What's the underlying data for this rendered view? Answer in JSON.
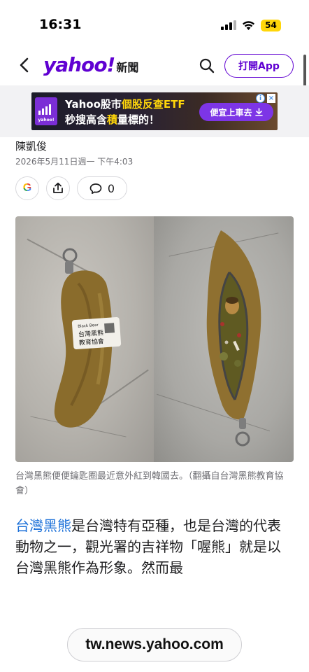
{
  "status_bar": {
    "time": "16:31",
    "battery": "54"
  },
  "header": {
    "brand": "yahoo!",
    "section": "新聞",
    "open_app_label": "打開App"
  },
  "ad": {
    "logo_text": "yahoo!",
    "line1_prefix": "Yahoo股市",
    "line1_highlight": "個股反查ETF",
    "line2_prefix": "秒搜高含",
    "line2_highlight": "積",
    "line2_suffix": "量標的！",
    "cta_label": "便宜上車去",
    "info_icon": "i",
    "close_icon": "×"
  },
  "article": {
    "author": "陳凱俊",
    "timestamp": "2026年5月11日週一 下午4:03",
    "comment_count": "0",
    "photo_tag_line1": "Black Bear",
    "photo_tag_line2": "台灣黑熊",
    "photo_tag_line3": "教育協會",
    "caption": "台灣黑熊便便鑰匙圈最近意外紅到韓國去。（翻攝自台灣黑熊教育協會）",
    "body_link": "台灣黑熊",
    "body_text": "是台灣特有亞種，也是台灣的代表動物之一，觀光署的吉祥物「喔熊」就是以台灣黑熊作為形象。然而最"
  },
  "browser": {
    "url": "tw.news.yahoo.com"
  },
  "colors": {
    "brand": "#6001d2",
    "link": "#1a6fd8",
    "ad_highlight": "#ffd60a",
    "battery": "#ffd60a"
  }
}
